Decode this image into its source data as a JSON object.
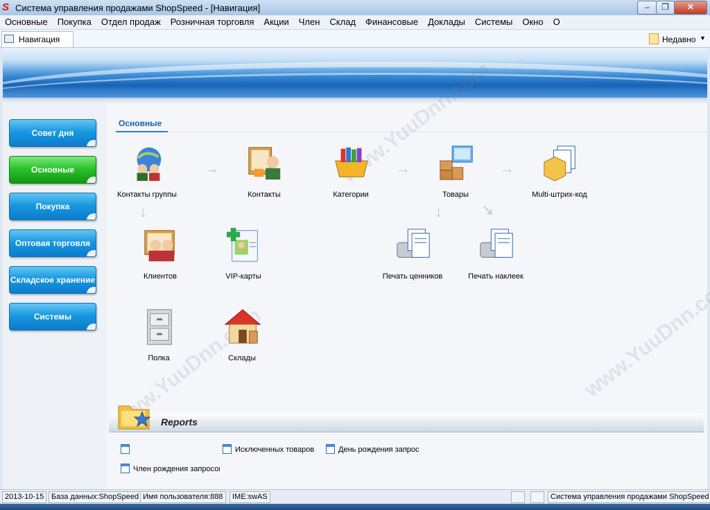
{
  "window": {
    "title": "Система управления продажами ShopSpeed - [Навигация]",
    "logo_letter": "S",
    "minimize": "–",
    "restore": "❐",
    "close": "✕"
  },
  "menu": [
    "Основные",
    "Покупка",
    "Отдел продаж",
    "Розничная торговля",
    "Акции",
    "Член",
    "Склад",
    "Финансовые",
    "Доклады",
    "Системы",
    "Окно",
    "О"
  ],
  "tab": {
    "label": "Навигация"
  },
  "recent": {
    "label": "Недавно",
    "chevron": "▼"
  },
  "sidebar": [
    {
      "label": "Совет дня",
      "active": false
    },
    {
      "label": "Основные",
      "active": true
    },
    {
      "label": "Покупка",
      "active": false
    },
    {
      "label": "Оптовая торговля",
      "active": false
    },
    {
      "label": "Складское хранение",
      "active": false
    },
    {
      "label": "Системы",
      "active": false
    }
  ],
  "section": {
    "title": "Основные"
  },
  "modules": [
    {
      "label": "Контакты группы",
      "icon": "contact-groups-icon"
    },
    {
      "label": "Контакты",
      "icon": "contacts-icon"
    },
    {
      "label": "Категории",
      "icon": "categories-icon"
    },
    {
      "label": "Товары",
      "icon": "products-icon"
    },
    {
      "label": "Multi-штрих-код",
      "icon": "multi-barcode-icon"
    },
    {
      "label": "Клиентов",
      "icon": "clients-icon"
    },
    {
      "label": "VIP-карты",
      "icon": "vip-card-icon"
    },
    {
      "label": "Печать ценников",
      "icon": "print-price-tags-icon"
    },
    {
      "label": "Печать наклеек",
      "icon": "print-labels-icon"
    },
    {
      "label": "Полка",
      "icon": "shelf-cabinet-icon"
    },
    {
      "label": "Склады",
      "icon": "warehouse-house-icon"
    }
  ],
  "reports": {
    "title": "Reports",
    "links": [
      {
        "label": ""
      },
      {
        "label": "Исключенных товаров"
      },
      {
        "label": "День рождения запрос"
      },
      {
        "label": "Член рождения запросов"
      }
    ]
  },
  "statusbar": {
    "date": "2013-10-15",
    "database": "База данных:ShopSpeed",
    "user": "Имя пользователя:888",
    "ime": "IME:swAS",
    "app": "Система управления продажами ShopSpeed"
  },
  "watermark": "www.YuuDnn.com",
  "colors": {
    "sidebar_button": "#1998e0",
    "sidebar_active": "#2bc42b",
    "section_title": "#1d5fa8"
  }
}
